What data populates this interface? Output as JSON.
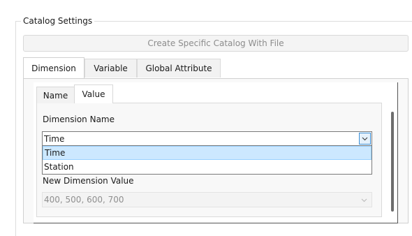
{
  "group": {
    "title": "Catalog Settings"
  },
  "create_button": {
    "label": "Create Specific Catalog With File"
  },
  "tabs": [
    {
      "label": "Dimension",
      "active": true
    },
    {
      "label": "Variable",
      "active": false
    },
    {
      "label": "Global Attribute",
      "active": false
    }
  ],
  "inner_tabs": [
    {
      "label": "Name",
      "active": false
    },
    {
      "label": "Value",
      "active": true
    }
  ],
  "dimension_name": {
    "label": "Dimension Name",
    "selected": "Time",
    "options": [
      "Time",
      "Station"
    ],
    "highlighted": "Time"
  },
  "new_dimension_value": {
    "label": "New Dimension Value",
    "value": "400, 500, 600, 700"
  },
  "icons": {
    "combo_open": "chevron-down-icon",
    "combo_disabled": "chevron-down-icon"
  },
  "colors": {
    "selection": "#cce8ff",
    "selection_border": "#99d1ff",
    "focus_button": "#e5f1fb",
    "focus_border": "#3c8fd6"
  }
}
